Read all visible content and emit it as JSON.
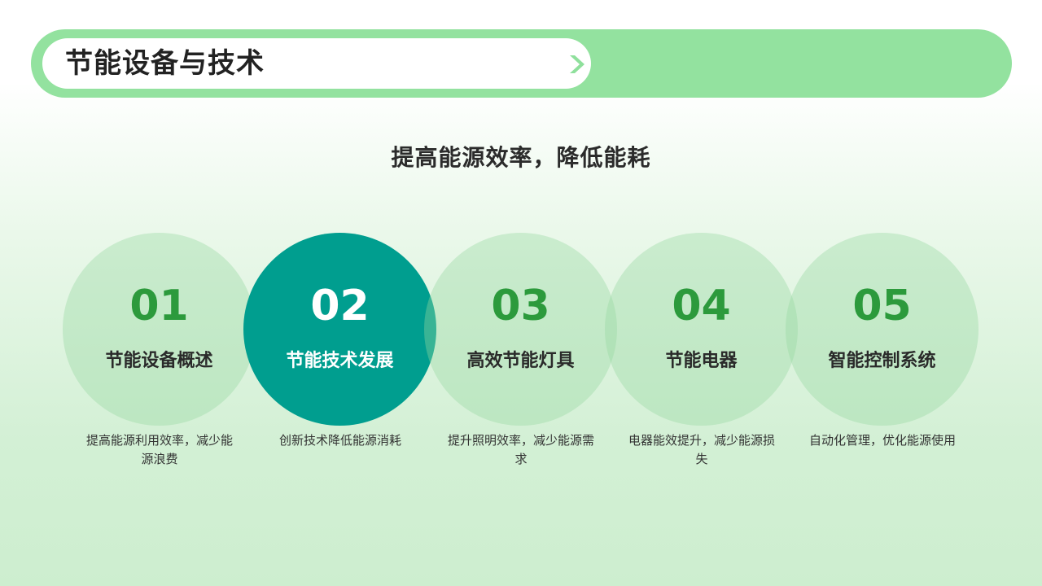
{
  "header": {
    "title": "节能设备与技术"
  },
  "subtitle": "提高能源效率，降低能耗",
  "items": [
    {
      "number": "01",
      "label": "节能设备概述",
      "desc": "提高能源利用效率，减少能源浪费"
    },
    {
      "number": "02",
      "label": "节能技术发展",
      "desc": "创新技术降低能源消耗"
    },
    {
      "number": "03",
      "label": "高效节能灯具",
      "desc": "提升照明效率，减少能源需求"
    },
    {
      "number": "04",
      "label": "节能电器",
      "desc": "电器能效提升，减少能源损失"
    },
    {
      "number": "05",
      "label": "智能控制系统",
      "desc": "自动化管理，优化能源使用"
    }
  ],
  "colors": {
    "header_bar": "#93e29f",
    "active_circle": "#009e8f",
    "number_green": "#2c9a3c",
    "chevron": "#8fe09c"
  },
  "icons": {
    "header_arrow": "chevron-right-icon"
  }
}
